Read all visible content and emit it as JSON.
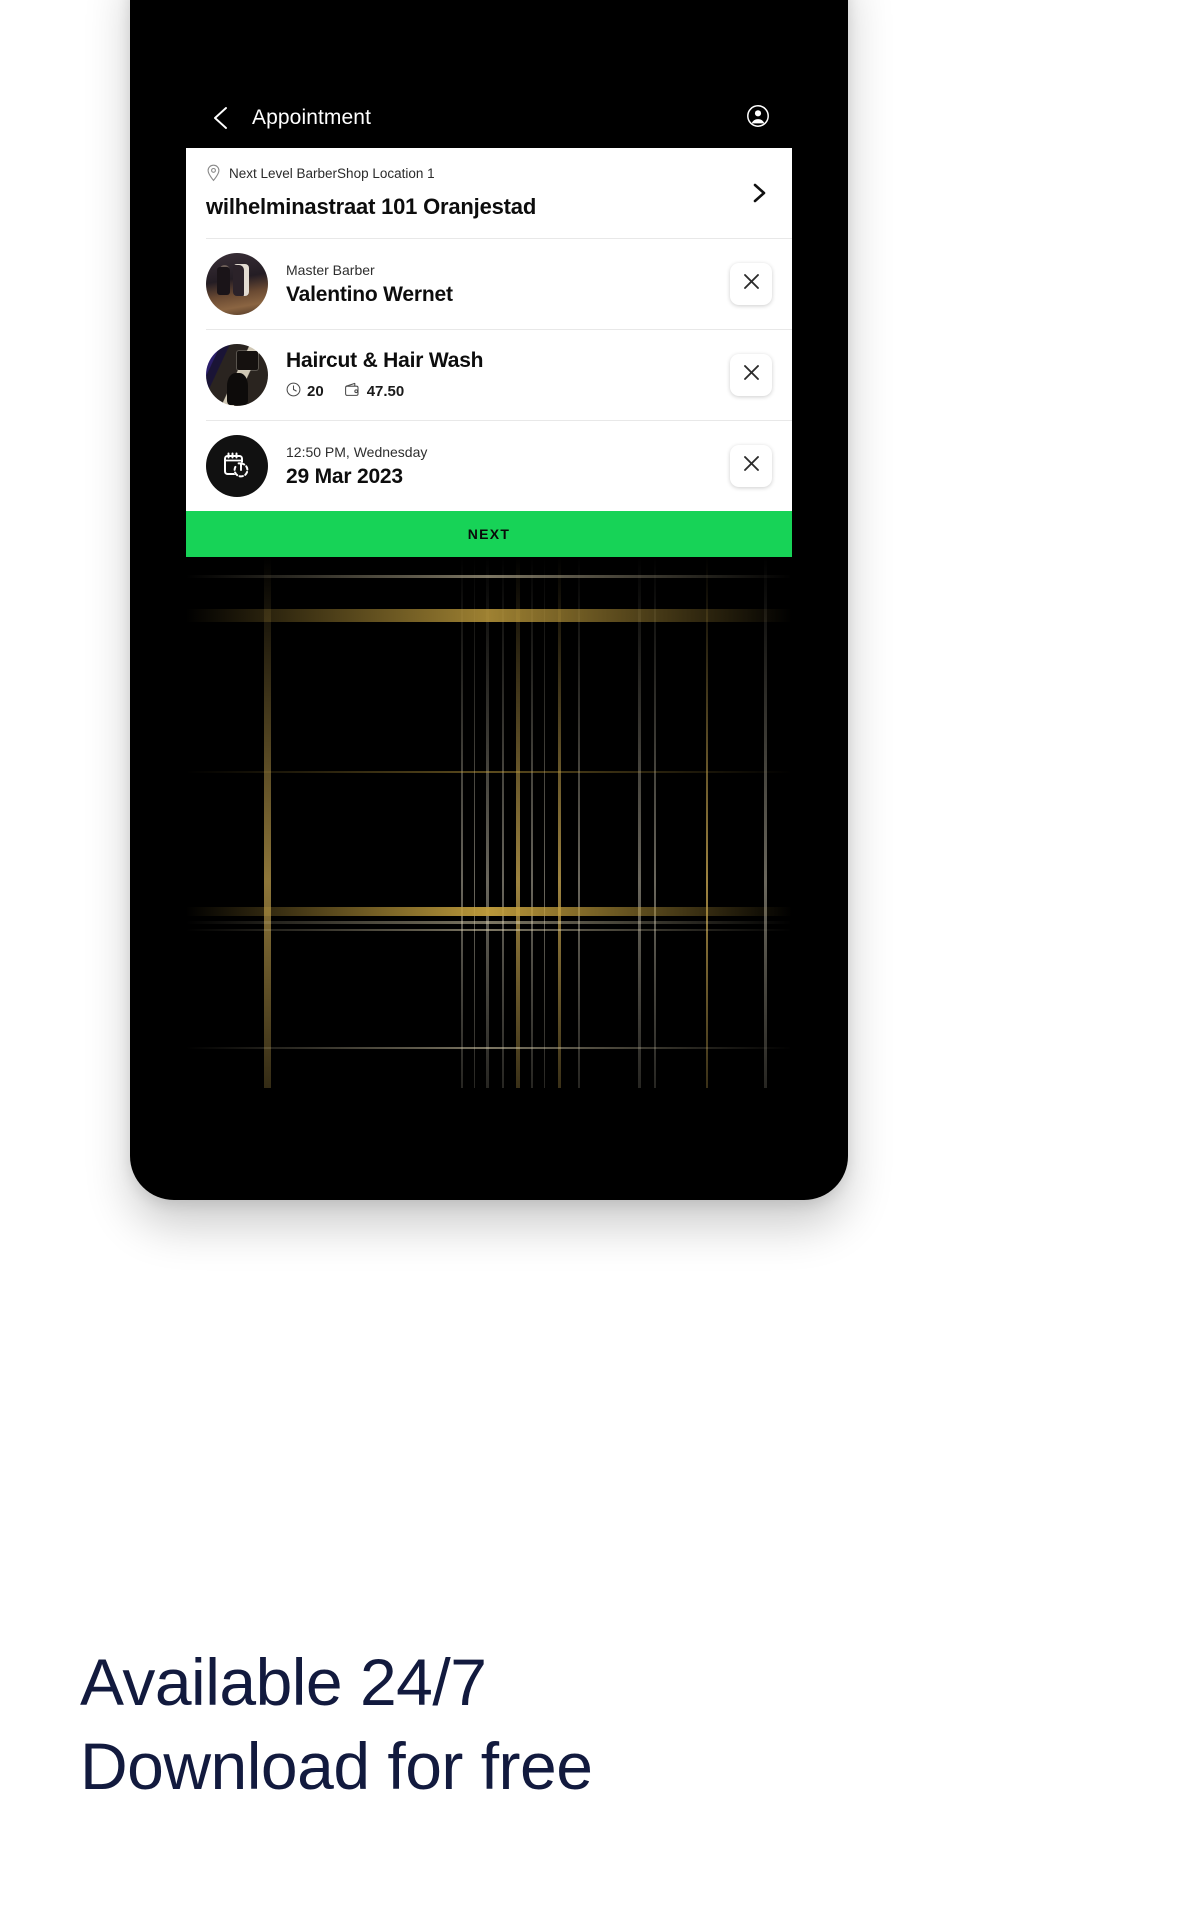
{
  "appbar": {
    "back_icon": "chevron-left-icon",
    "title": "Appointment",
    "account_icon": "account-circle-icon"
  },
  "location_card": {
    "pin_icon": "map-pin-icon",
    "shop_name": "Next Level BarberShop Location 1",
    "address": "wilhelminastraat 101 Oranjestad",
    "chevron_icon": "chevron-right-icon"
  },
  "rows": [
    {
      "label": "Master Barber",
      "title": "Valentino Wernet",
      "thumb": "barber-photo",
      "close_icon": "close-icon"
    },
    {
      "title": "Haircut & Hair Wash",
      "duration_icon": "clock-icon",
      "duration": "20",
      "price_icon": "wallet-icon",
      "price": "47.50",
      "thumb": "service-photo",
      "close_icon": "close-icon"
    },
    {
      "label": "12:50 PM,  Wednesday",
      "title": "29 Mar 2023",
      "thumb": "calendar-clock-icon",
      "close_icon": "close-icon"
    }
  ],
  "cta": {
    "next_label": "NEXT",
    "color": "#17d357"
  },
  "promo": {
    "line1": "Available 24/7",
    "line2": "Download for free",
    "color": "#121a3e"
  }
}
